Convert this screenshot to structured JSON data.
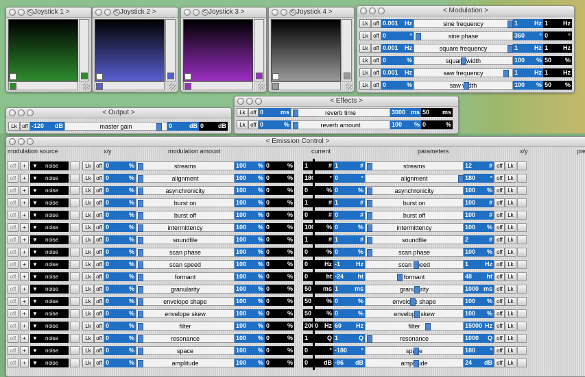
{
  "joysticks": [
    {
      "title": "< Joystick 1 >",
      "color": "#2e8c2e"
    },
    {
      "title": "< Joystick 2 >",
      "color": "#5a5fd0"
    },
    {
      "title": "< Joystick 3 >",
      "color": "#9a2fc2"
    },
    {
      "title": "< Joystick 4 >",
      "color": "#9a9a9a"
    }
  ],
  "modulation": {
    "title": "< Modulation >",
    "rows": [
      {
        "lk": "Lk",
        "off": "off",
        "val": "0.001",
        "unit": "Hz",
        "label": "sine frequency",
        "v1": "1",
        "u1": "Hz",
        "v2": "1",
        "u2": "Hz"
      },
      {
        "lk": "Lk",
        "off": "off",
        "val": "0",
        "unit": "°",
        "label": "sine phase",
        "v1": "360",
        "u1": "°",
        "v2": "0",
        "u2": "°"
      },
      {
        "lk": "Lk",
        "off": "off",
        "val": "0.001",
        "unit": "Hz",
        "label": "square frequency",
        "v1": "1",
        "u1": "Hz",
        "v2": "1",
        "u2": "Hz"
      },
      {
        "lk": "Lk",
        "off": "off",
        "val": "0",
        "unit": "%",
        "label": "square width",
        "v1": "100",
        "u1": "%",
        "v2": "50",
        "u2": "%"
      },
      {
        "lk": "Lk",
        "off": "off",
        "val": "0.001",
        "unit": "Hz",
        "label": "saw frequency",
        "v1": "1",
        "u1": "Hz",
        "v2": "1",
        "u2": "Hz"
      },
      {
        "lk": "Lk",
        "off": "off",
        "val": "0",
        "unit": "%",
        "label": "saw width",
        "v1": "100",
        "u1": "%",
        "v2": "50",
        "u2": "%"
      }
    ]
  },
  "effects": {
    "title": "< Effects >",
    "rows": [
      {
        "lk": "Lk",
        "off": "off",
        "val": "0",
        "unit": "ms",
        "label": "reverb time",
        "v1": "3000",
        "u1": "ms",
        "v2": "50",
        "u2": "ms"
      },
      {
        "lk": "Lk",
        "off": "off",
        "val": "0",
        "unit": "%",
        "label": "reverb amount",
        "v1": "100",
        "u1": "%",
        "v2": "0",
        "u2": "%"
      }
    ]
  },
  "output": {
    "title": "< Output >",
    "lk": "Lk",
    "off": "off",
    "val": "-120",
    "unit": "dB",
    "label": "master gain",
    "v1": "0",
    "u1": "dB",
    "v2": "0",
    "u2": "dB"
  },
  "emission": {
    "title": "< Emission Control >",
    "headers": {
      "mod_source": "modulation source",
      "xy_left": "x/y",
      "mod_amount": "modulation amount",
      "current": "current",
      "parameters": "parameters",
      "xy_right": "x/y",
      "pre": "pre"
    },
    "src_label": "noise",
    "plus": "+",
    "caret": "▼",
    "rows": [
      {
        "amt": "0",
        "amt_u": "%",
        "label": "streams",
        "v100": "100",
        "v100_u": "%",
        "v0": "0",
        "v0_u": "%",
        "cur": "1",
        "cur_u": "#",
        "p1": "1",
        "p1_u": "#",
        "plabel": "streams",
        "p2": "12",
        "p2_u": "#"
      },
      {
        "amt": "0",
        "amt_u": "%",
        "label": "alignment",
        "v100": "100",
        "v100_u": "%",
        "v0": "0",
        "v0_u": "%",
        "cur": "180",
        "cur_u": "°",
        "p1": "0",
        "p1_u": "°",
        "plabel": "alignment",
        "p2": "180",
        "p2_u": "°"
      },
      {
        "amt": "0",
        "amt_u": "%",
        "label": "asynchronicity",
        "v100": "100",
        "v100_u": "%",
        "v0": "0",
        "v0_u": "%",
        "cur": "0",
        "cur_u": "%",
        "p1": "0",
        "p1_u": "%",
        "plabel": "asynchronicity",
        "p2": "100",
        "p2_u": "%"
      },
      {
        "amt": "0",
        "amt_u": "%",
        "label": "burst on",
        "v100": "100",
        "v100_u": "%",
        "v0": "0",
        "v0_u": "%",
        "cur": "1",
        "cur_u": "#",
        "p1": "1",
        "p1_u": "#",
        "plabel": "burst on",
        "p2": "100",
        "p2_u": "#"
      },
      {
        "amt": "0",
        "amt_u": "%",
        "label": "burst off",
        "v100": "100",
        "v100_u": "%",
        "v0": "0",
        "v0_u": "%",
        "cur": "0",
        "cur_u": "#",
        "p1": "0",
        "p1_u": "#",
        "plabel": "burst off",
        "p2": "100",
        "p2_u": "#"
      },
      {
        "amt": "0",
        "amt_u": "%",
        "label": "intermittency",
        "v100": "100",
        "v100_u": "%",
        "v0": "0",
        "v0_u": "%",
        "cur": "100",
        "cur_u": "%",
        "p1": "0",
        "p1_u": "%",
        "plabel": "intermittency",
        "p2": "100",
        "p2_u": "%"
      },
      {
        "amt": "0",
        "amt_u": "%",
        "label": "soundfile",
        "v100": "100",
        "v100_u": "%",
        "v0": "0",
        "v0_u": "%",
        "cur": "1",
        "cur_u": "#",
        "p1": "1",
        "p1_u": "#",
        "plabel": "soundfile",
        "p2": "2",
        "p2_u": "#"
      },
      {
        "amt": "0",
        "amt_u": "%",
        "label": "scan phase",
        "v100": "100",
        "v100_u": "%",
        "v0": "0",
        "v0_u": "%",
        "cur": "0",
        "cur_u": "%",
        "p1": "0",
        "p1_u": "%",
        "plabel": "scan phase",
        "p2": "100",
        "p2_u": "%"
      },
      {
        "amt": "0",
        "amt_u": "%",
        "label": "scan speed",
        "v100": "100",
        "v100_u": "%",
        "v0": "0",
        "v0_u": "%",
        "cur": "0",
        "cur_u": "Hz",
        "p1": "-1",
        "p1_u": "Hz",
        "plabel": "scan speed",
        "p2": "1",
        "p2_u": "Hz"
      },
      {
        "amt": "0",
        "amt_u": "%",
        "label": "formant",
        "v100": "100",
        "v100_u": "%",
        "v0": "0",
        "v0_u": "%",
        "cur": "0",
        "cur_u": "ht",
        "p1": "-24",
        "p1_u": "ht",
        "plabel": "formant",
        "p2": "48",
        "p2_u": "ht"
      },
      {
        "amt": "0",
        "amt_u": "%",
        "label": "granularity",
        "v100": "100",
        "v100_u": "%",
        "v0": "0",
        "v0_u": "%",
        "cur": "50",
        "cur_u": "ms",
        "p1": "1",
        "p1_u": "ms",
        "plabel": "granularity",
        "p2": "1000",
        "p2_u": "ms"
      },
      {
        "amt": "0",
        "amt_u": "%",
        "label": "envelope shape",
        "v100": "100",
        "v100_u": "%",
        "v0": "0",
        "v0_u": "%",
        "cur": "50",
        "cur_u": "%",
        "p1": "0",
        "p1_u": "%",
        "plabel": "envelope shape",
        "p2": "100",
        "p2_u": "%"
      },
      {
        "amt": "0",
        "amt_u": "%",
        "label": "envelope skew",
        "v100": "100",
        "v100_u": "%",
        "v0": "0",
        "v0_u": "%",
        "cur": "50",
        "cur_u": "%",
        "p1": "0",
        "p1_u": "%",
        "plabel": "envelope skew",
        "p2": "100",
        "p2_u": "%"
      },
      {
        "amt": "0",
        "amt_u": "%",
        "label": "filter",
        "v100": "100",
        "v100_u": "%",
        "v0": "0",
        "v0_u": "%",
        "cur": "2000",
        "cur_u": "Hz",
        "p1": "60",
        "p1_u": "Hz",
        "plabel": "filter",
        "p2": "15000",
        "p2_u": "Hz"
      },
      {
        "amt": "0",
        "amt_u": "%",
        "label": "resonance",
        "v100": "100",
        "v100_u": "%",
        "v0": "0",
        "v0_u": "%",
        "cur": "1",
        "cur_u": "Q",
        "p1": "1",
        "p1_u": "Q",
        "plabel": "resonance",
        "p2": "1000",
        "p2_u": "Q"
      },
      {
        "amt": "0",
        "amt_u": "%",
        "label": "space",
        "v100": "100",
        "v100_u": "%",
        "v0": "0",
        "v0_u": "%",
        "cur": "0",
        "cur_u": "°",
        "p1": "-180",
        "p1_u": "°",
        "plabel": "space",
        "p2": "180",
        "p2_u": "°"
      },
      {
        "amt": "0",
        "amt_u": "%",
        "label": "amplitude",
        "v100": "100",
        "v100_u": "%",
        "v0": "0",
        "v0_u": "%",
        "cur": "0",
        "cur_u": "dB",
        "p1": "-96",
        "p1_u": "dB",
        "plabel": "amplitude",
        "p2": "24",
        "p2_u": "dB"
      }
    ]
  }
}
